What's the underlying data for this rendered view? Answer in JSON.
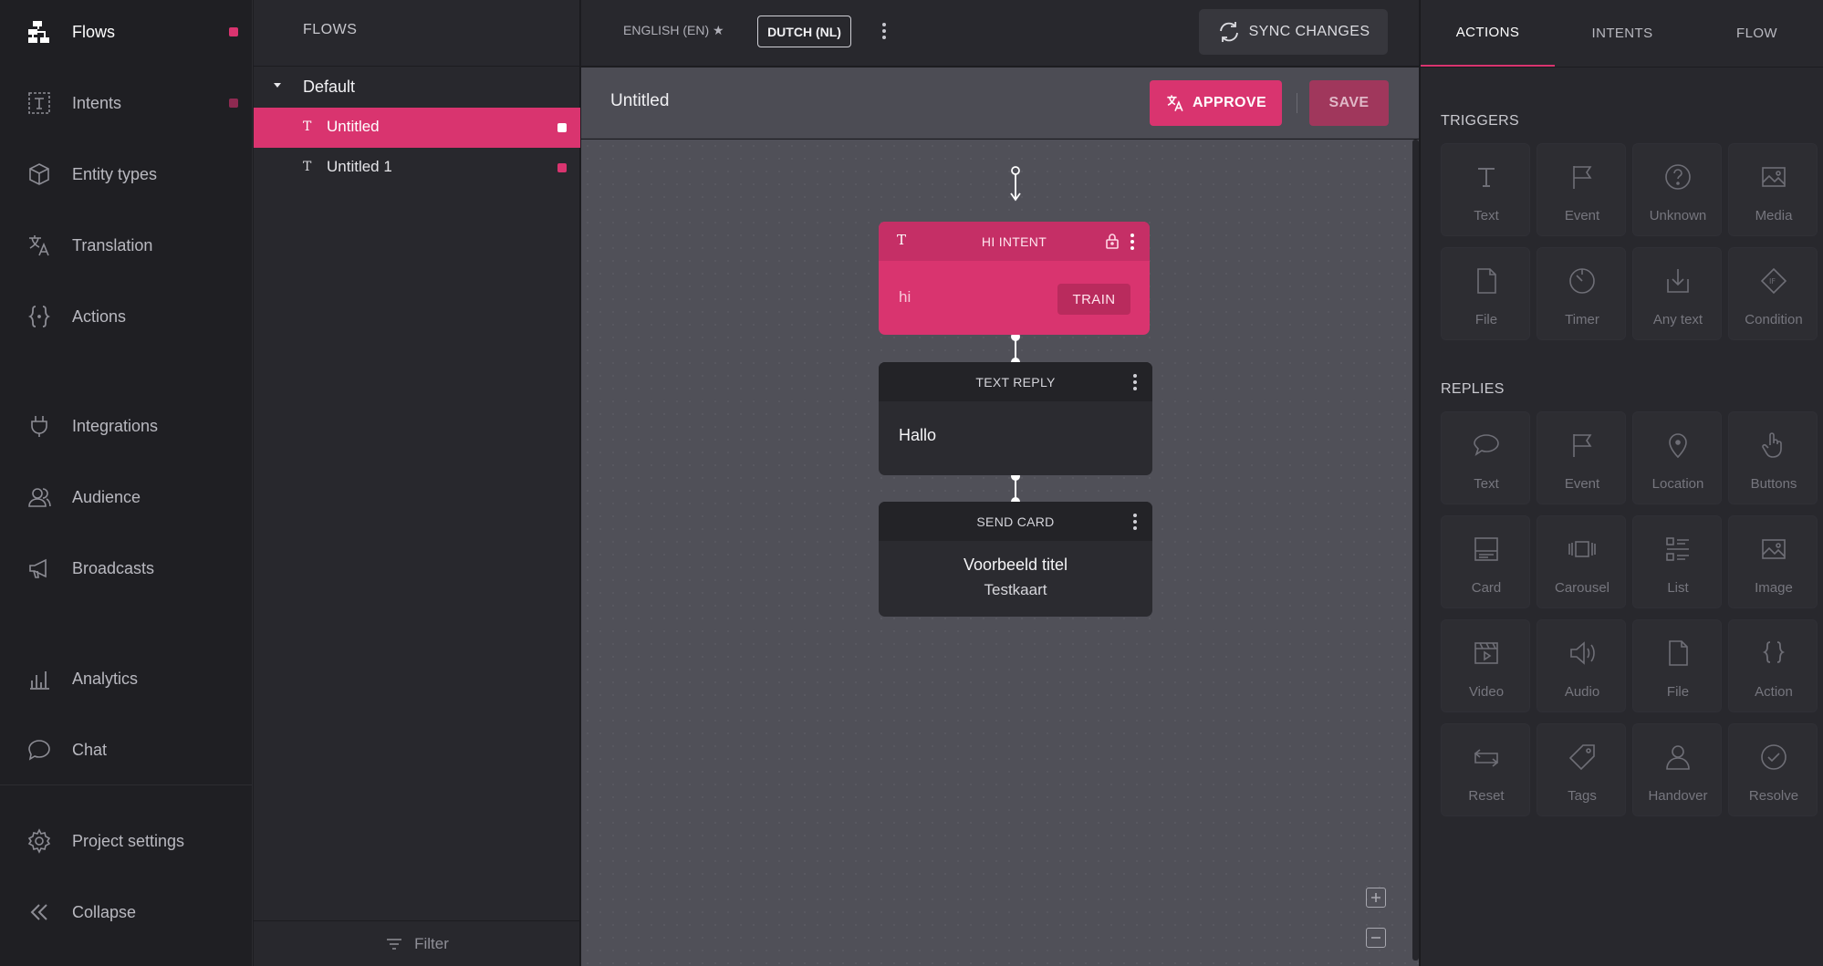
{
  "nav": {
    "items": [
      {
        "label": "Flows",
        "icon": "flows-icon",
        "dot": true
      },
      {
        "label": "Intents",
        "icon": "intents-icon",
        "dot": true
      },
      {
        "label": "Entity types",
        "icon": "entity-types-icon"
      },
      {
        "label": "Translation",
        "icon": "translation-icon"
      },
      {
        "label": "Actions",
        "icon": "actions-icon"
      },
      {
        "label": "Integrations",
        "icon": "integrations-icon"
      },
      {
        "label": "Audience",
        "icon": "audience-icon"
      },
      {
        "label": "Broadcasts",
        "icon": "broadcasts-icon"
      },
      {
        "label": "Analytics",
        "icon": "analytics-icon"
      },
      {
        "label": "Chat",
        "icon": "chat-icon"
      },
      {
        "label": "Project settings",
        "icon": "gear-icon"
      },
      {
        "label": "Collapse",
        "icon": "collapse-icon"
      }
    ]
  },
  "flows": {
    "header": "FLOWS",
    "group": "Default",
    "items": [
      {
        "label": "Untitled",
        "selected": true
      },
      {
        "label": "Untitled 1",
        "selected": false
      }
    ],
    "filter_label": "Filter"
  },
  "topbar": {
    "lang_primary": "ENGLISH (EN) ★",
    "lang_active": "DUTCH (NL)",
    "sync_label": "SYNC CHANGES"
  },
  "canvas": {
    "title": "Untitled",
    "approve_label": "APPROVE",
    "save_label": "SAVE",
    "nodes": {
      "intent": {
        "header": "HI INTENT",
        "glyph": "T",
        "text": "hi",
        "train_label": "TRAIN"
      },
      "text_reply": {
        "header": "TEXT REPLY",
        "text": "Hallo"
      },
      "send_card": {
        "header": "SEND CARD",
        "title": "Voorbeeld titel",
        "subtitle": "Testkaart"
      }
    }
  },
  "right_panel": {
    "tabs": [
      "ACTIONS",
      "INTENTS",
      "FLOW"
    ],
    "triggers_title": "TRIGGERS",
    "triggers": [
      "Text",
      "Event",
      "Unknown",
      "Media",
      "File",
      "Timer",
      "Any text",
      "Condition"
    ],
    "replies_title": "REPLIES",
    "replies": [
      "Text",
      "Event",
      "Location",
      "Buttons",
      "Card",
      "Carousel",
      "List",
      "Image",
      "Video",
      "Audio",
      "File",
      "Action",
      "Reset",
      "Tags",
      "Handover",
      "Resolve"
    ]
  },
  "colors": {
    "accent": "#d9346f",
    "background": "#1f1f23",
    "canvas": "#505058"
  }
}
